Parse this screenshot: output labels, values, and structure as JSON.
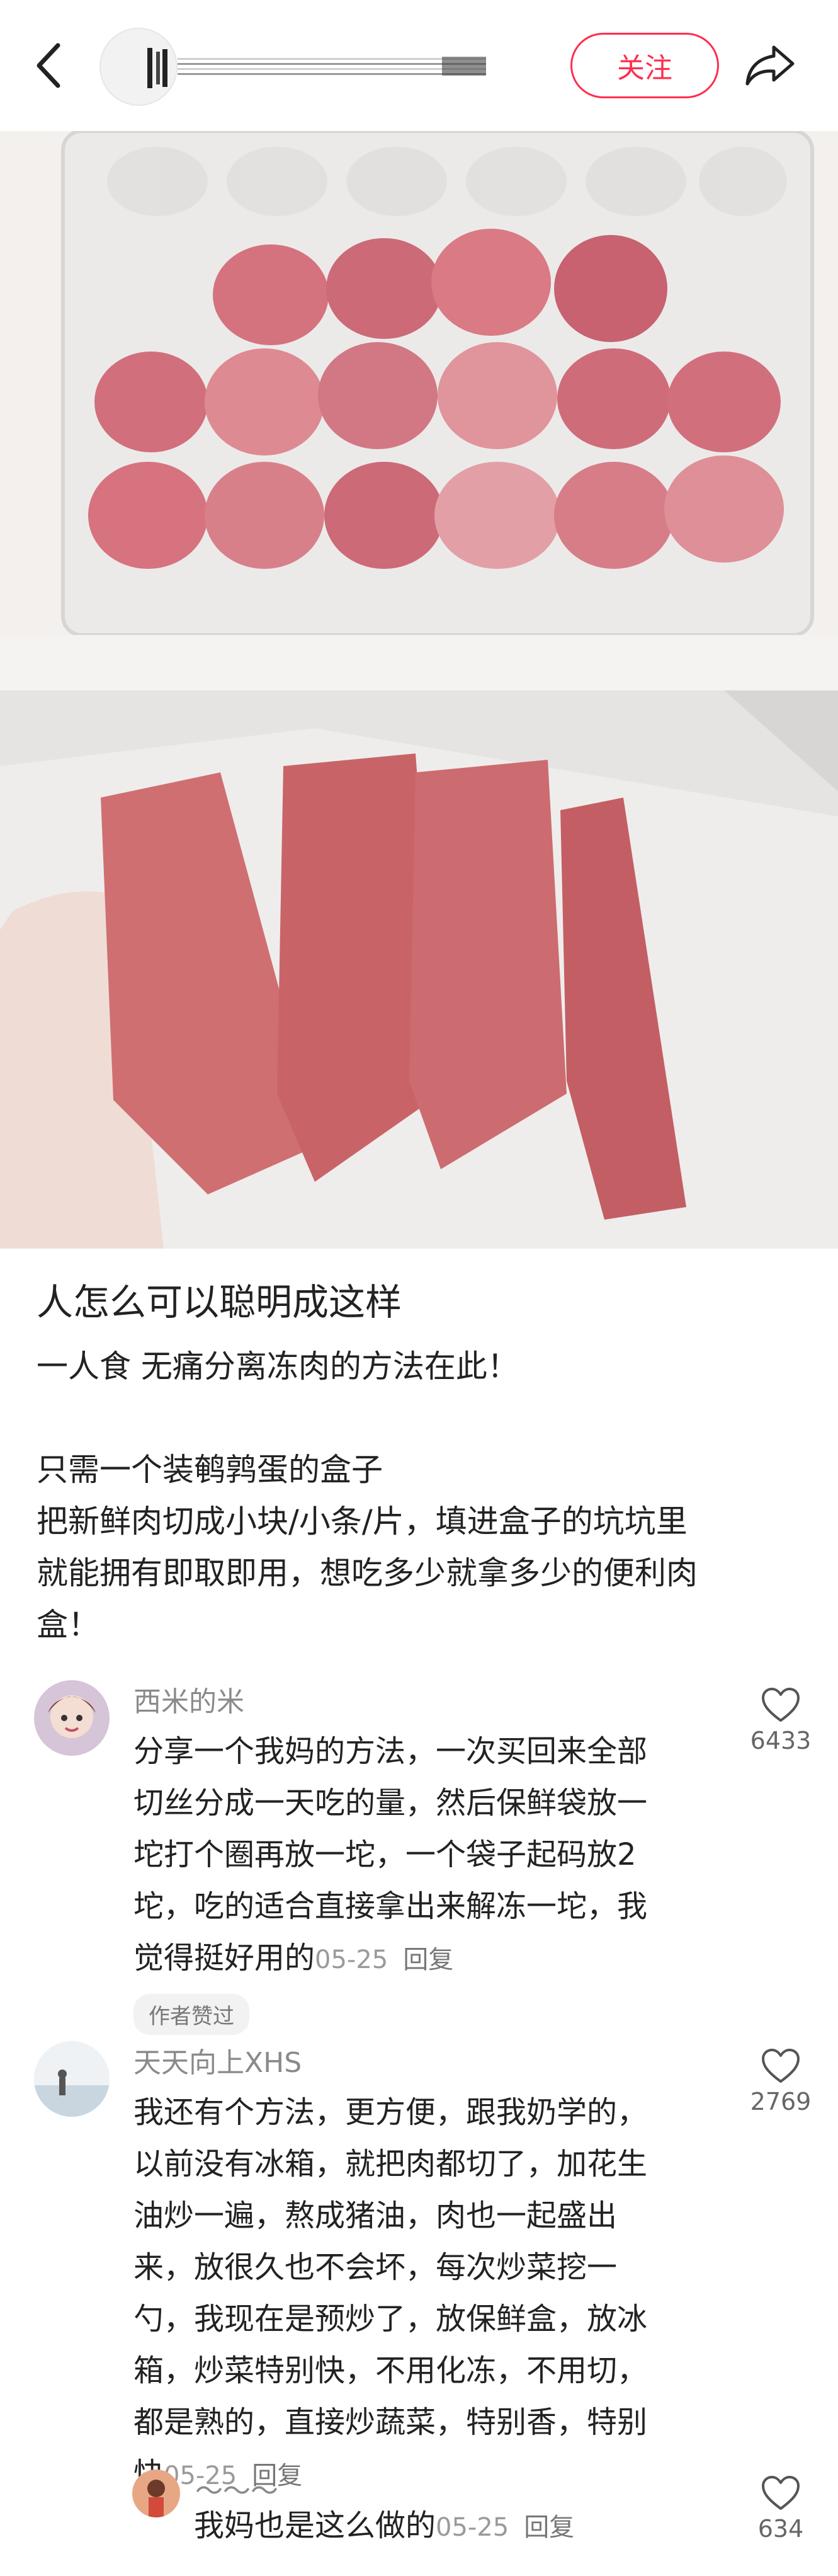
{
  "header": {
    "follow_label": "关注"
  },
  "post": {
    "title": "人怎么可以聪明成这样",
    "lines": [
      "一人食  无痛分离冻肉的方法在此！",
      "只需一个装鹌鹑蛋的盒子",
      "把新鲜肉切成小块/小条/片，填进盒子的坑坑里",
      "就能拥有即取即用，想吃多少就拿多少的便利肉",
      "盒！"
    ]
  },
  "comments": [
    {
      "name": "西米的米",
      "lines": [
        "分享一个我妈的方法，一次买回来全部",
        "切丝分成一天吃的量，然后保鲜袋放一",
        "坨打个圈再放一坨，一个袋子起码放2",
        "坨，吃的适合直接拿出来解冻一坨，我",
        "觉得挺好用的"
      ],
      "date": "05-25",
      "reply_label": "回复",
      "likes": "6433",
      "badge": "作者赞过"
    },
    {
      "name": "天天向上XHS",
      "lines": [
        "我还有个方法，更方便，跟我奶学的，",
        "以前没有冰箱，就把肉都切了，加花生",
        "油炒一遍，熬成猪油，肉也一起盛出",
        "来，放很久也不会坏，每次炒菜挖一",
        "勺，我现在是预炒了，放保鲜盒，放冰",
        "箱，炒菜特别快，不用化冻，不用切，",
        "都是熟的，直接炒蔬菜，特别香，特别",
        "快"
      ],
      "date": "05-25",
      "reply_label": "回复",
      "likes": "2769"
    },
    {
      "name": "～～～",
      "text": "我妈也是这么做的",
      "date": "05-25",
      "reply_label": "回复",
      "likes": "634"
    }
  ],
  "colors": {
    "accent": "#ff2e4d",
    "muted": "#8a8a8a"
  },
  "icons": {
    "back": "chevron-left-icon",
    "share": "share-arrow-icon",
    "like": "heart-outline-icon"
  }
}
